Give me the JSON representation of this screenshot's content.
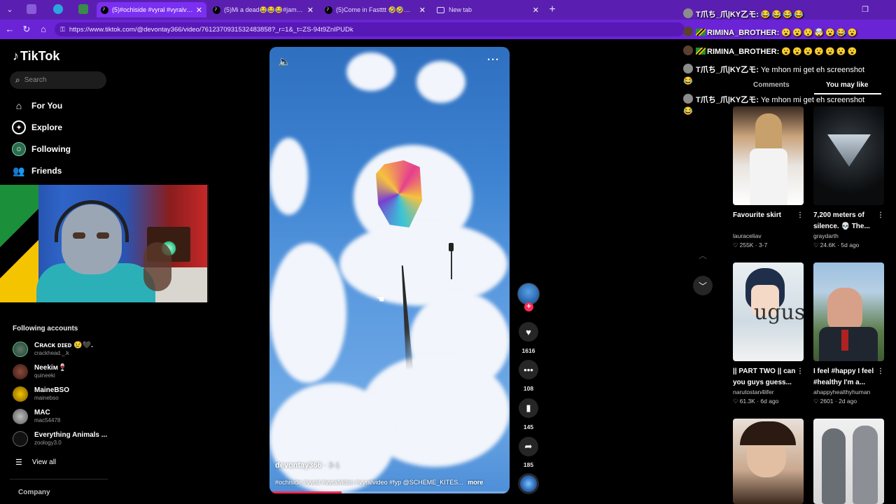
{
  "browser": {
    "tabs": [
      {
        "title": "(5)#ochiside #vyral #vyralvideo #v",
        "active": true
      },
      {
        "title": "(5)Mi a dead😂😂😂#jamaica #j",
        "active": false
      },
      {
        "title": "(5)Come in Fastttt 🤣🤣🤣 lir",
        "active": false
      },
      {
        "title": "New tab",
        "active": false
      }
    ],
    "url": "https://www.tiktok.com/@devontay366/video/7612370931532483858?_r=1&_t=ZS-94t9ZnIPUDk"
  },
  "sidebar": {
    "logo": "TikTok",
    "search_placeholder": "Search",
    "nav": [
      {
        "label": "For You",
        "icon": "home-icon"
      },
      {
        "label": "Explore",
        "icon": "compass-icon"
      },
      {
        "label": "Following",
        "icon": "following-icon"
      },
      {
        "label": "Friends",
        "icon": "friends-icon"
      }
    ],
    "following_title": "Following accounts",
    "accounts": [
      {
        "name": "Cʀᴀᴄᴋ ᴅɪᴇᴅ 😢🖤.",
        "handle": "crackhead._.k"
      },
      {
        "name": "Neekiм🍷",
        "handle": "quineeki"
      },
      {
        "name": "MaineBSO",
        "handle": "mainebso"
      },
      {
        "name": "MAC",
        "handle": "mac54478"
      },
      {
        "name": "Everything Animals ...",
        "handle": "zoology3.0"
      }
    ],
    "view_all": "View all",
    "company": "Company"
  },
  "video": {
    "author": "devontay366",
    "date": "· 3-1",
    "caption": "#ochiside #vyral #vyralvideo #vyralvideo #fyp @SCHEME_KITES...",
    "more": "more",
    "progress": 0.3,
    "likes": "1616",
    "comments": "108",
    "saves": "145",
    "shares": "185"
  },
  "chat": [
    {
      "user": "T爪ち_爪|KY乙モ:",
      "message": "",
      "emoji": "😂😂😂😂"
    },
    {
      "user": "RIMINA_BROTHER:",
      "message": "",
      "emoji": "😮😮😯🤯😮😂😮"
    },
    {
      "user": "RIMINA_BROTHER:",
      "message": "",
      "emoji": "😮😮😮😮😮😮😮"
    },
    {
      "user": "T爪ち_爪|KY乙モ:",
      "message": "Ye mhon mi get eh screenshot",
      "emoji": "😂"
    },
    {
      "user": "T爪ち_爪|KY乙モ:",
      "message": "Ye mhon mi get eh screenshot",
      "emoji": "😂"
    }
  ],
  "right_panel": {
    "tabs": [
      "Comments",
      "You may like"
    ],
    "cards": [
      {
        "title": "Favourite skirt",
        "author": "lauraceliav",
        "likes": "255K",
        "date": "3-7"
      },
      {
        "title": "7,200 meters of silence. 💀 The...",
        "author": "graydarth",
        "likes": "24.6K",
        "date": "5d ago"
      },
      {
        "title": "|| PART TWO || can you guys guess...",
        "author": "narutostan4lifer",
        "likes": "61.3K",
        "date": "6d ago"
      },
      {
        "title": "I feel #happy I feel #healthy I'm a...",
        "author": "ahappyhealthyhuman",
        "likes": "2601",
        "date": "2d ago"
      },
      {
        "title": "",
        "author": "",
        "likes": "",
        "date": ""
      },
      {
        "title": "",
        "author": "",
        "likes": "",
        "date": ""
      }
    ]
  },
  "colors": {
    "browser_frame": "#5a1fb0",
    "tiktok_red": "#fe2c55",
    "background": "#000000"
  }
}
